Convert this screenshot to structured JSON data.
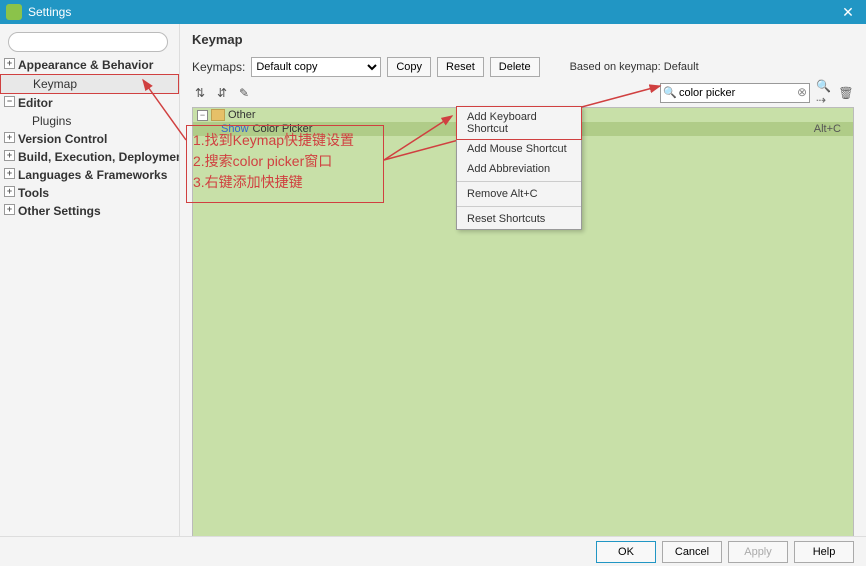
{
  "window": {
    "title": "Settings"
  },
  "sidebar": {
    "search_placeholder": "",
    "items": [
      {
        "label": "Appearance & Behavior",
        "expandable": true
      },
      {
        "label": "Keymap",
        "sub": true,
        "selected": true
      },
      {
        "label": "Editor",
        "expandable": true
      },
      {
        "label": "Plugins",
        "sub": true
      },
      {
        "label": "Version Control",
        "expandable": true
      },
      {
        "label": "Build, Execution, Deployment",
        "expandable": true
      },
      {
        "label": "Languages & Frameworks",
        "expandable": true
      },
      {
        "label": "Tools",
        "expandable": true
      },
      {
        "label": "Other Settings",
        "expandable": true
      }
    ]
  },
  "page": {
    "title": "Keymap",
    "keymaps_label": "Keymaps:",
    "keymaps_value": "Default copy",
    "copy": "Copy",
    "reset": "Reset",
    "delete": "Delete",
    "based_label": "Based on keymap:",
    "based_value": "Default"
  },
  "search": {
    "value": "color picker"
  },
  "tree": {
    "root": "Other",
    "item_label": "Show",
    "item_name": "Color Picker",
    "shortcut": "Alt+C"
  },
  "context_menu": {
    "items": [
      "Add Keyboard Shortcut",
      "Add Mouse Shortcut",
      "Add Abbreviation",
      "Remove Alt+C",
      "Reset Shortcuts"
    ]
  },
  "annotations": {
    "line1": "1.找到Keymap快捷键设置",
    "line2": "2.搜索color picker窗口",
    "line3": "3.右键添加快捷键"
  },
  "footer": {
    "ok": "OK",
    "cancel": "Cancel",
    "apply": "Apply",
    "help": "Help"
  }
}
